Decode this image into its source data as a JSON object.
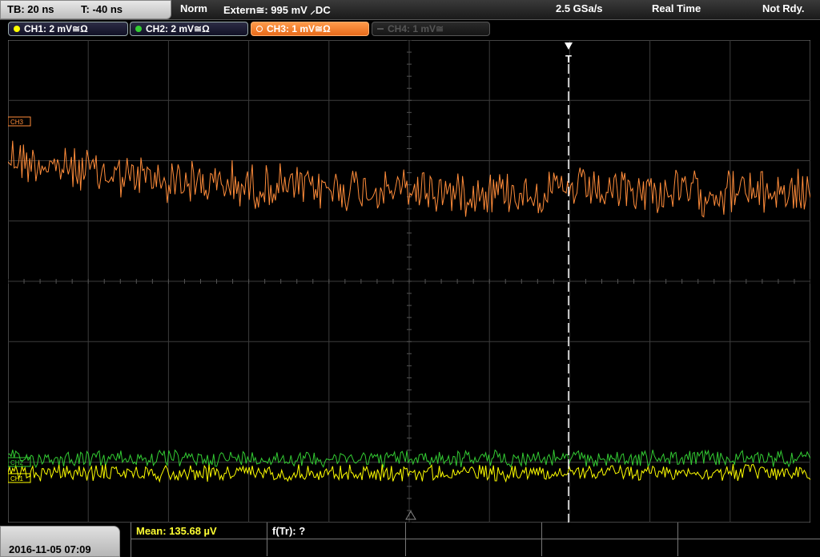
{
  "top_bar": {
    "timebase": "TB: 20 ns",
    "trigger_time": "T: -40 ns",
    "trigger_mode": "Norm",
    "trigger_source": "Extern≅: 995 mV ⸝DC",
    "sample_rate": "2.5 GSa/s",
    "acq_mode": "Real Time",
    "status": "Not Rdy."
  },
  "channels": [
    {
      "label": "CH1: 2 mV≅Ω",
      "color": "#ffff00",
      "state": "on"
    },
    {
      "label": "CH2: 2 mV≅Ω",
      "color": "#33cc33",
      "state": "on"
    },
    {
      "label": "CH3: 1 mV≅Ω",
      "color": "#ff8c3a",
      "state": "selected"
    },
    {
      "label": "CH4: 1 mV≅",
      "color": "#777777",
      "state": "off"
    }
  ],
  "trigger_marker": "T",
  "waveform_labels": {
    "ch3": "CH3",
    "ch2": "CH2",
    "ch1": "CH1"
  },
  "measurements": {
    "mean": "Mean: 135.68 µV",
    "freq": "f(Tr): ?"
  },
  "datetime": "2016-11-05 07:09",
  "colors": {
    "ch1": "#ffff00",
    "ch2": "#33cc33",
    "ch3": "#ff8c3a",
    "grid": "#3c3c3c",
    "mean_text": "#ffff33"
  }
}
